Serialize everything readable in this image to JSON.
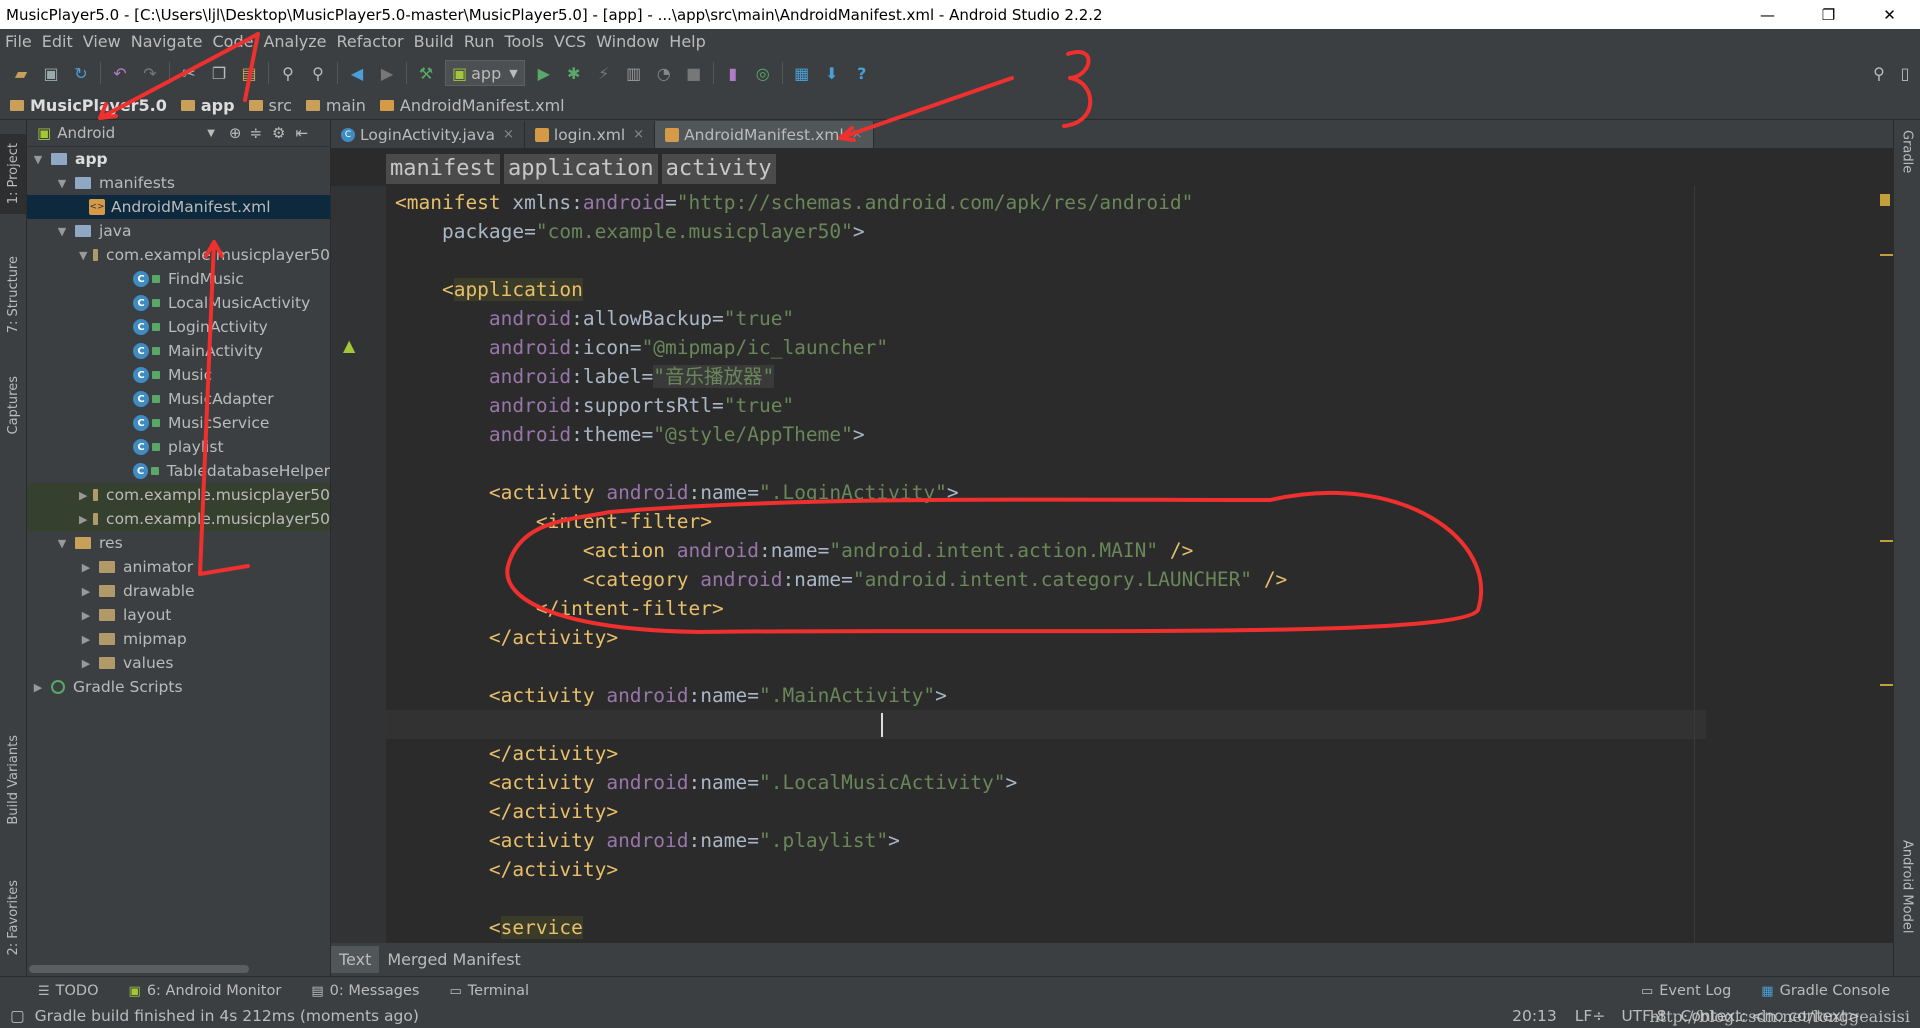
{
  "window": {
    "title": "MusicPlayer5.0 - [C:\\Users\\ljl\\Desktop\\MusicPlayer5.0-master\\MusicPlayer5.0] - [app] - ...\\app\\src\\main\\AndroidManifest.xml - Android Studio 2.2.2",
    "minimize": "—",
    "maximize": "❐",
    "close": "✕"
  },
  "menu": [
    "File",
    "Edit",
    "View",
    "Navigate",
    "Code",
    "Analyze",
    "Refactor",
    "Build",
    "Run",
    "Tools",
    "VCS",
    "Window",
    "Help"
  ],
  "toolbar": {
    "run_config": "app"
  },
  "breadcrumb": [
    "MusicPlayer5.0",
    "app",
    "src",
    "main",
    "AndroidManifest.xml"
  ],
  "left_strip": {
    "project": "1: Project",
    "structure": "7: Structure",
    "captures": "Captures",
    "build_variants": "Build Variants",
    "favorites": "2: Favorites"
  },
  "right_strip": {
    "gradle": "Gradle",
    "android_model": "Android Model"
  },
  "project_panel": {
    "view": "Android",
    "tree": {
      "app": "app",
      "manifests": "manifests",
      "manifest_file": "AndroidManifest.xml",
      "java": "java",
      "package_main": "com.example.musicplayer50",
      "classes": [
        "FindMusic",
        "LocalMusicActivity",
        "LoginActivity",
        "MainActivity",
        "Music",
        "MusicAdapter",
        "MusicService",
        "playlist",
        "TabledatabaseHelper"
      ],
      "package_test1": "com.example.musicplayer50",
      "package_test2": "com.example.musicplayer50",
      "res": "res",
      "res_dirs": [
        "animator",
        "drawable",
        "layout",
        "mipmap",
        "values"
      ],
      "gradle": "Gradle Scripts"
    }
  },
  "editor_tabs": [
    {
      "label": "LoginActivity.java"
    },
    {
      "label": "login.xml"
    },
    {
      "label": "AndroidManifest.xml"
    }
  ],
  "xml_breadcrumb": [
    "manifest",
    "application",
    "activity"
  ],
  "code": {
    "l1_tag": "<manifest ",
    "l1_attr": "xmlns:",
    "l1_ns": "android",
    "l1_eq": "=",
    "l1_val": "\"http://schemas.android.com/apk/res/android\"",
    "l2_attr": "    package=",
    "l2_val": "\"com.example.musicplayer50\"",
    "l2_end": ">",
    "l4_open": "    <",
    "l4_tag": "application",
    "allowBackup_val": "\"true\"",
    "icon_val": "\"@mipmap/ic_launcher\"",
    "label_val": "\"音乐播放器\"",
    "rtl_val": "\"true\"",
    "theme_val": "\"@style/AppTheme\"",
    "login_activity": "\".LoginActivity\"",
    "intent_filter_open": "<intent-filter>",
    "action_val": "\"android.intent.action.MAIN\"",
    "category_val": "\"android.intent.category.LAUNCHER\"",
    "intent_filter_close": "</intent-filter>",
    "activity_close": "</activity>",
    "main_activity": "\".MainActivity\"",
    "local_activity": "\".LocalMusicActivity\"",
    "playlist_activity": "\".playlist\"",
    "service_tag": "service"
  },
  "bottom_tabs": [
    "Text",
    "Merged Manifest"
  ],
  "tool_windows": [
    "TODO",
    "6: Android Monitor",
    "0: Messages",
    "Terminal"
  ],
  "tool_windows_right": [
    "Event Log",
    "Gradle Console"
  ],
  "status": {
    "message": "Gradle build finished in 4s 212ms (moments ago)",
    "position": "20:13",
    "line_sep": "LF÷",
    "encoding": "UTF-8",
    "context": "Context: <no context>"
  },
  "annotation_number": "3",
  "watermark": "http://blog.csdn.net/longgeaisisi"
}
